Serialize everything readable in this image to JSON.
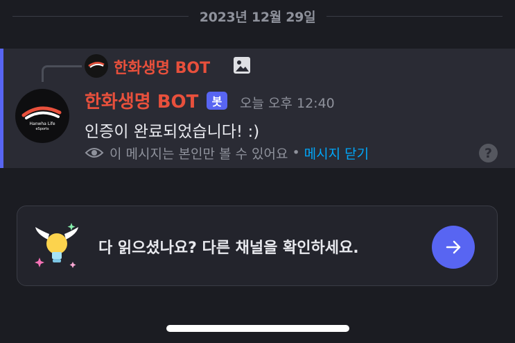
{
  "date_divider": "2023년 12월 29일",
  "reply": {
    "author": "한화생명 BOT",
    "attachment_icon": "image-icon"
  },
  "message": {
    "author": "한화생명 BOT",
    "bot_tag": "봇",
    "timestamp": "오늘 오후 12:40",
    "content": "인증이 완료되었습니다! :)",
    "ephemeral_notice": "이 메시지는 본인만 볼 수 있어요",
    "separator": "•",
    "dismiss_label": "메시지 닫기",
    "help_icon_glyph": "?",
    "avatar_text_top": "Hanwha Life",
    "avatar_text_bottom": "eSports"
  },
  "read_prompt": {
    "text": "다 읽으셨나요? 다른 채널을 확인하세요.",
    "icon": "winged-lightbulb-icon",
    "button_icon": "arrow-right-icon"
  },
  "colors": {
    "accent": "#5865f2",
    "author_name": "#e8503c",
    "link": "#00a8fc"
  }
}
